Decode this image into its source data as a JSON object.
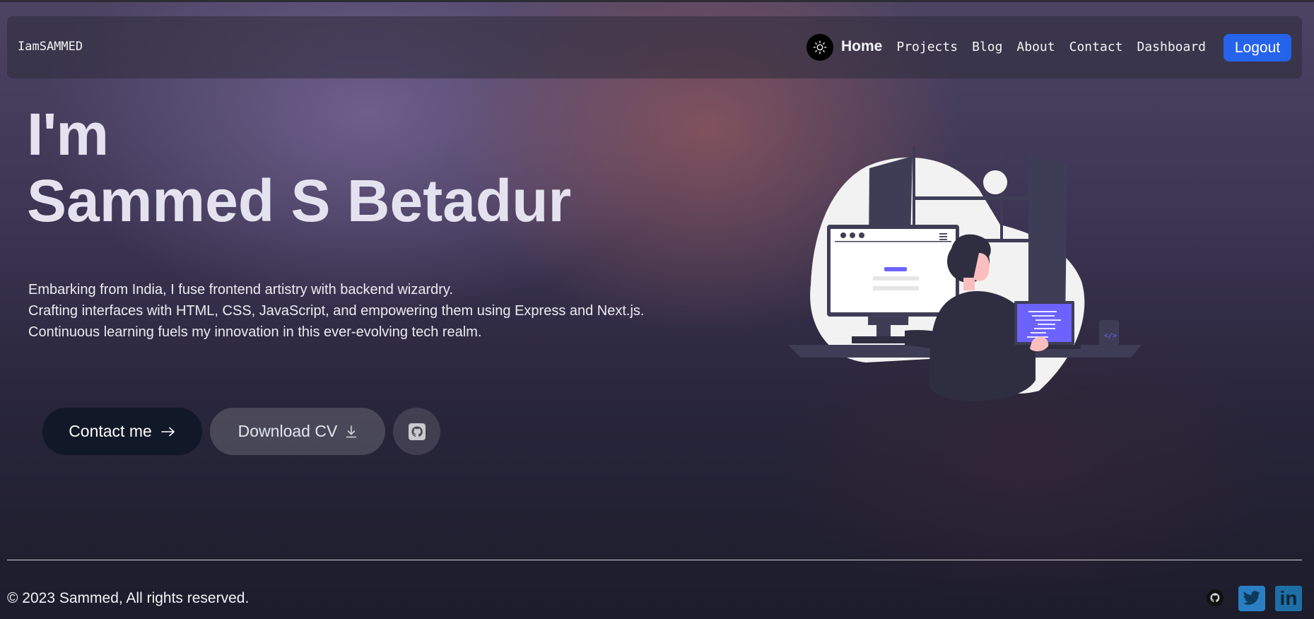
{
  "navbar": {
    "brand": "IamSAMMED",
    "theme_toggle_icon": "sun-icon",
    "links": [
      "Home",
      "Projects",
      "Blog",
      "About",
      "Contact",
      "Dashboard"
    ],
    "active_link": "Home",
    "logout_label": "Logout",
    "logout_color": "#2563eb"
  },
  "hero": {
    "greeting": "I'm",
    "name": "Sammed S Betadur",
    "description": [
      "Embarking from India, I fuse frontend artistry with backend wizardry.",
      "Crafting interfaces with HTML, CSS, JavaScript, and empowering them using Express and Next.js.",
      "Continuous learning fuels my innovation in this ever-evolving tech realm."
    ],
    "contact_label": "Contact me",
    "contact_icon": "arrow-right-icon",
    "cv_label": "Download CV",
    "cv_icon": "download-icon",
    "github_icon": "github-icon",
    "illustration": "developer-at-desk-illustration",
    "accent_color": "#6c63ff"
  },
  "footer": {
    "copyright": "© 2023 Sammed, All rights reserved.",
    "social_icons": [
      "github-icon",
      "twitter-icon",
      "linkedin-icon"
    ],
    "linkedin_text": "in"
  }
}
